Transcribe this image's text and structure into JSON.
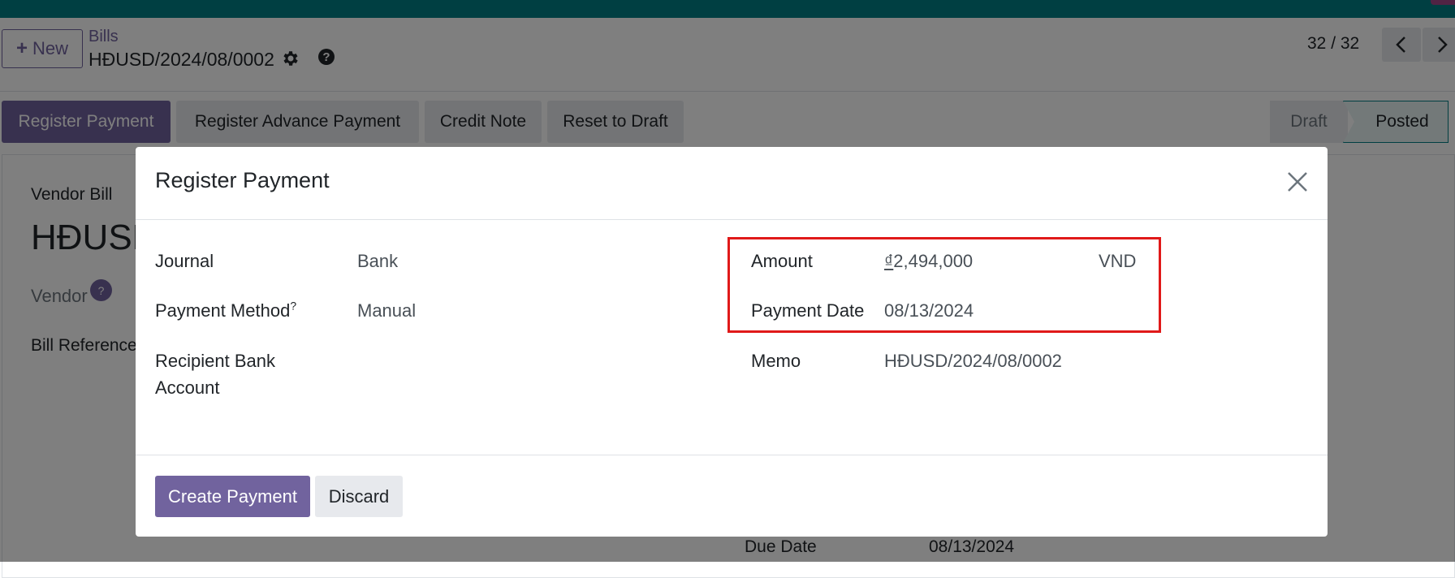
{
  "control_panel": {
    "new_label": "New",
    "breadcrumb_parent": "Bills",
    "breadcrumb_current": "HĐUSD/2024/08/0002",
    "pager": "32 / 32"
  },
  "status_bar": {
    "buttons": [
      "Register Payment",
      "Register Advance Payment",
      "Credit Note",
      "Reset to Draft"
    ],
    "stages": [
      "Draft",
      "Posted"
    ],
    "active_stage": "Posted"
  },
  "background_form": {
    "type_label": "Vendor Bill",
    "title": "HĐUSD",
    "vendor_label": "Vendor",
    "vendor_help": "?",
    "bill_reference_label": "Bill Reference",
    "due_date_label": "Due Date",
    "due_date_value": "08/13/2024"
  },
  "dialog": {
    "title": "Register Payment",
    "left_fields": {
      "journal_label": "Journal",
      "journal_value": "Bank",
      "payment_method_label": "Payment Method",
      "payment_method_help": "?",
      "payment_method_value": "Manual",
      "recipient_bank_label_line1": "Recipient Bank",
      "recipient_bank_label_line2": "Account"
    },
    "right_fields": {
      "amount_label": "Amount",
      "amount_currency_symbol": "₫",
      "amount_value": "2,494,000",
      "amount_currency": "VND",
      "payment_date_label": "Payment Date",
      "payment_date_value": "08/13/2024",
      "memo_label": "Memo",
      "memo_value": "HĐUSD/2024/08/0002"
    },
    "create_label": "Create Payment",
    "discard_label": "Discard"
  },
  "colors": {
    "brand_topbar": "#017e84",
    "primary": "#71639e",
    "highlight": "#e01919"
  }
}
